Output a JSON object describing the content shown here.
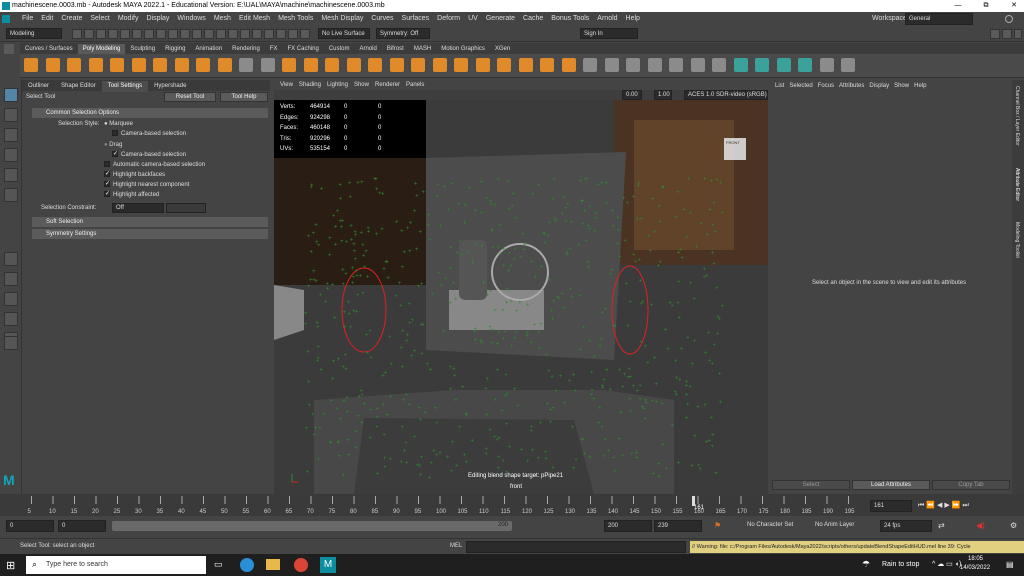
{
  "window": {
    "title": "machinescene.0003.mb - Autodesk MAYA 2022.1 - Educational Version: E:\\UAL\\MAYA\\machine\\machinescene.0003.mb",
    "tab_label": "machinescene.0003.mb",
    "controls": [
      "—",
      "⧉",
      "✕"
    ]
  },
  "menubar": {
    "items": [
      "File",
      "Edit",
      "Create",
      "Select",
      "Modify",
      "Display",
      "Windows",
      "Mesh",
      "Edit Mesh",
      "Mesh Tools",
      "Mesh Display",
      "Curves",
      "Surfaces",
      "Deform",
      "UV",
      "Generate",
      "Cache",
      "Bonus Tools",
      "Arnold",
      "Help"
    ],
    "workspace_label": "Workspace:",
    "workspace_value": "General"
  },
  "statusline": {
    "mode": "Modeling",
    "live_surface": "No Live Surface",
    "symmetry": "Symmetry: Off",
    "sign_in": "Sign In"
  },
  "shelf": {
    "tabs": [
      "Curves / Surfaces",
      "Poly Modeling",
      "Sculpting",
      "Rigging",
      "Animation",
      "Rendering",
      "FX",
      "FX Caching",
      "Custom",
      "Arnold",
      "Bifrost",
      "MASH",
      "Motion Graphics",
      "XGen"
    ],
    "active_tab": "Poly Modeling"
  },
  "tool_panel": {
    "tabs": [
      "Outliner",
      "Shape Editor",
      "Tool Settings",
      "Hypershade"
    ],
    "active_tab": "Tool Settings",
    "tool_name": "Select Tool",
    "reset_button": "Reset Tool",
    "help_button": "Tool Help",
    "common_section": "Common Selection Options",
    "selection_style_label": "Selection Style:",
    "marquee": "Marquee",
    "camera_based_selection": "Camera-based selection",
    "drag": "Drag",
    "camera_based_selection_2": "Camera-based selection",
    "auto_camera": "Automatic camera-based selection",
    "highlight_backfaces": "Highlight backfaces",
    "highlight_nearest": "Highlight nearest component",
    "highlight_affected": "Highlight affected",
    "constraint_label": "Selection Constraint:",
    "constraint_value": "Off",
    "soft_selection": "Soft Selection",
    "symmetry_settings": "Symmetry Settings"
  },
  "viewport": {
    "menu": [
      "View",
      "Shading",
      "Lighting",
      "Show",
      "Renderer",
      "Panels"
    ],
    "exposure": "0.00",
    "gamma": "1.00",
    "color_space": "ACES 1.0 SDR-video (sRGB)",
    "hud": [
      {
        "label": "Verts:",
        "a": "464914",
        "b": "0",
        "c": "0"
      },
      {
        "label": "Edges:",
        "a": "924298",
        "b": "0",
        "c": "0"
      },
      {
        "label": "Faces:",
        "a": "460148",
        "b": "0",
        "c": "0"
      },
      {
        "label": "Tris:",
        "a": "920296",
        "b": "0",
        "c": "0"
      },
      {
        "label": "UVs:",
        "a": "535154",
        "b": "0",
        "c": "0"
      }
    ],
    "blend_shape_msg": "Editing blend shape target: pPipe21",
    "camera_name": "front",
    "view_cube_label": "FRONT",
    "colors": {
      "wire_green": "#2e8b2e",
      "wire_red": "#e02020",
      "bg": "#3a3a3a"
    }
  },
  "attribute_editor": {
    "menu": [
      "List",
      "Selected",
      "Focus",
      "Attributes",
      "Display",
      "Show",
      "Help"
    ],
    "empty_msg": "Select an object in the scene to view and edit its attributes",
    "buttons": [
      "Select",
      "Load Attributes",
      "Copy Tab"
    ],
    "side_tabs": [
      "Channel Box / Layer Editor",
      "Attribute Editor",
      "Modeling Toolkit"
    ]
  },
  "timeline": {
    "ticks": [
      "5",
      "10",
      "15",
      "20",
      "25",
      "30",
      "35",
      "40",
      "45",
      "50",
      "55",
      "60",
      "65",
      "70",
      "75",
      "80",
      "85",
      "90",
      "95",
      "100",
      "105",
      "110",
      "115",
      "120",
      "125",
      "130",
      "135",
      "140",
      "145",
      "150",
      "155",
      "160",
      "165",
      "170",
      "175",
      "180",
      "185",
      "190",
      "195"
    ],
    "current_frame_marker": "161",
    "current_frame_field": "161"
  },
  "range": {
    "start": "0",
    "anim_start": "0",
    "range_end_label": "200",
    "anim_end": "200",
    "end": "239",
    "character_set": "No Character Set",
    "anim_layer": "No Anim Layer",
    "fps": "24 fps"
  },
  "helpline": {
    "message": "Select Tool: select an object",
    "mel_label": "MEL",
    "warning": "// Warning: file: c:/Program Files/Autodesk/Maya2022/scripts/others/updateBlendShapeEditHUD.mel line 39: Cycle"
  },
  "taskbar": {
    "search_placeholder": "Type here to search",
    "weather": "Rain to stop",
    "time": "18:05",
    "date": "14/03/2022"
  }
}
